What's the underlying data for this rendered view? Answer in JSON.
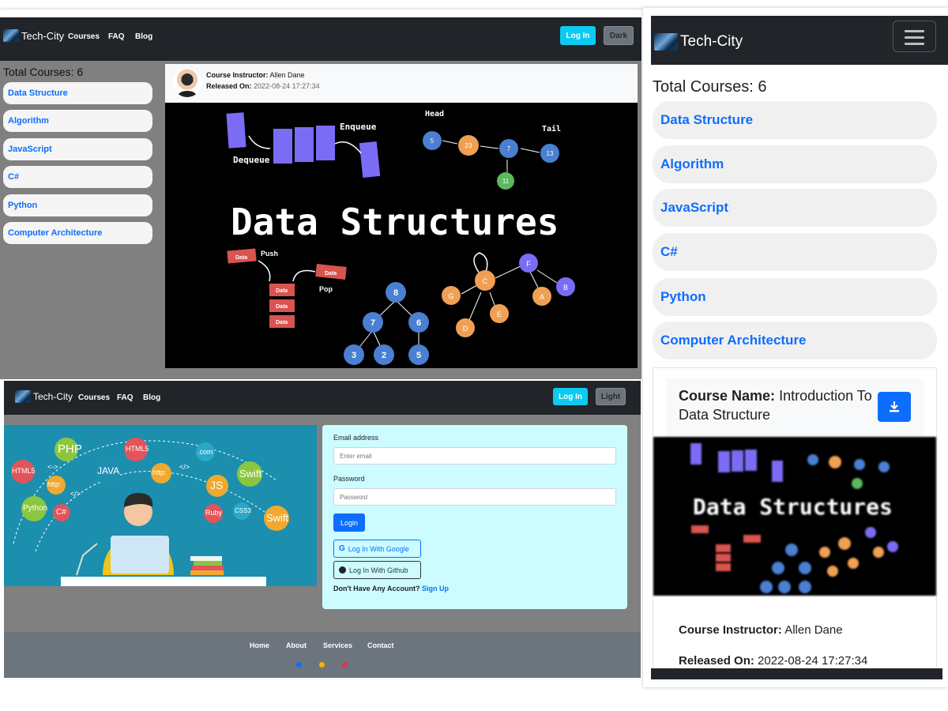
{
  "brand": {
    "name": "Tech-City"
  },
  "nav": {
    "links": [
      "Courses",
      "FAQ",
      "Blog"
    ],
    "login_label": "Log In"
  },
  "theme_dark_label": "Dark",
  "theme_light_label": "Light",
  "courses": {
    "total_label": "Total Courses: 6",
    "items": [
      "Data Structure",
      "Algorithm",
      "JavaScript",
      "C#",
      "Python",
      "Computer Architecture"
    ]
  },
  "course_detail": {
    "instructor_label": "Course Instructor:",
    "instructor": "Allen Dane",
    "released_label": "Released On:",
    "released": "2022-08-24 17:27:34",
    "name_label": "Course Name:",
    "name": "Introduction To Data Structure"
  },
  "banner": {
    "title": "Data Structures",
    "labels": {
      "enqueue": "Enqueue",
      "dequeue": "Dequeue",
      "head": "Head",
      "tail": "Tail",
      "push": "Push",
      "pop": "Pop",
      "data": "Data"
    },
    "list_nodes": [
      "5",
      "23",
      "7",
      "13",
      "11"
    ],
    "tree_nodes": [
      "8",
      "7",
      "6",
      "3",
      "2",
      "5"
    ],
    "graph_nodes": [
      "C",
      "F",
      "G",
      "D",
      "E",
      "A",
      "B"
    ]
  },
  "hero_tags": [
    "PHP",
    "HTML5",
    ".com",
    "HTML5",
    "JAVA",
    "http:",
    "http:",
    "Swift",
    "JS",
    "Python",
    "C#",
    "Ruby",
    "CSS3",
    "Swift",
    "<->",
    "</>",
    "</>"
  ],
  "login_form": {
    "email_label": "Email address",
    "email_placeholder": "Enter email",
    "password_label": "Password",
    "password_placeholder": "Password",
    "login_button": "Login",
    "google_button": "Log In With Google",
    "github_button": "Log In With Github",
    "signup_prompt": "Don't Have Any Account?",
    "signup_link": "Sign Up"
  },
  "footer": {
    "links": [
      "Home",
      "About",
      "Services",
      "Contact"
    ]
  },
  "colors": {
    "navbar": "#212529",
    "accent_blue": "#0d6efd",
    "accent_cyan": "#0dcaf0",
    "gray_body": "#808080",
    "footer": "#6c757d",
    "login_card": "#ccfcff",
    "social_facebook": "#0d6efd",
    "social_instagram": "#f0b400",
    "social_youtube": "#dc3545"
  }
}
